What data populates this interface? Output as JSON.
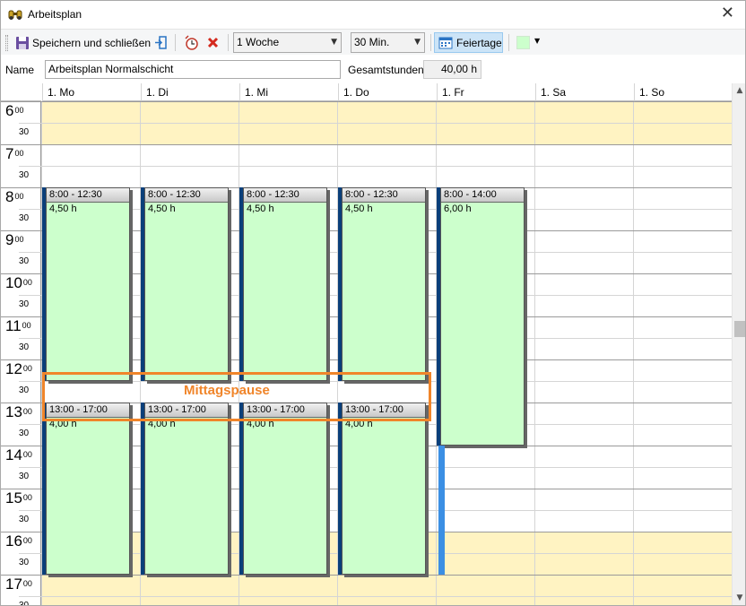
{
  "window": {
    "title": "Arbeitsplan",
    "close_icon": "✕"
  },
  "toolbar": {
    "save_close_label": "Speichern und schließen",
    "period_value": "1 Woche",
    "interval_value": "30 Min.",
    "holidays_label": "Feiertage",
    "color_value": "#ccffcc"
  },
  "form": {
    "name_label": "Name",
    "name_value": "Arbeitsplan Normalschicht",
    "total_label": "Gesamtstunden",
    "total_value": "40,00 h"
  },
  "days": [
    "1. Mo",
    "1. Di",
    "1. Mi",
    "1. Do",
    "1. Fr",
    "1. Sa",
    "1. So"
  ],
  "hours": [
    "6",
    "7",
    "8",
    "9",
    "10",
    "11",
    "12",
    "13",
    "14",
    "15",
    "16",
    "17"
  ],
  "minutes": {
    "full": "00",
    "half": "30"
  },
  "colors": {
    "working_area": "#ffffff",
    "off_hours": "#fff3c2",
    "appointment": "#ccffcc",
    "break_highlight": "#f0852a"
  },
  "appointments": [
    {
      "day": 0,
      "start": 8.0,
      "end": 12.5,
      "label": "8:00 - 12:30",
      "duration": "4,50 h"
    },
    {
      "day": 1,
      "start": 8.0,
      "end": 12.5,
      "label": "8:00 - 12:30",
      "duration": "4,50 h"
    },
    {
      "day": 2,
      "start": 8.0,
      "end": 12.5,
      "label": "8:00 - 12:30",
      "duration": "4,50 h"
    },
    {
      "day": 3,
      "start": 8.0,
      "end": 12.5,
      "label": "8:00 - 12:30",
      "duration": "4,50 h"
    },
    {
      "day": 4,
      "start": 8.0,
      "end": 14.0,
      "label": "8:00 - 14:00",
      "duration": "6,00 h"
    },
    {
      "day": 0,
      "start": 13.0,
      "end": 17.0,
      "label": "13:00 - 17:00",
      "duration": "4,00 h"
    },
    {
      "day": 1,
      "start": 13.0,
      "end": 17.0,
      "label": "13:00 - 17:00",
      "duration": "4,00 h"
    },
    {
      "day": 2,
      "start": 13.0,
      "end": 17.0,
      "label": "13:00 - 17:00",
      "duration": "4,00 h"
    },
    {
      "day": 3,
      "start": 13.0,
      "end": 17.0,
      "label": "13:00 - 17:00",
      "duration": "4,00 h"
    }
  ],
  "annotation": {
    "label": "Mittagspause"
  }
}
